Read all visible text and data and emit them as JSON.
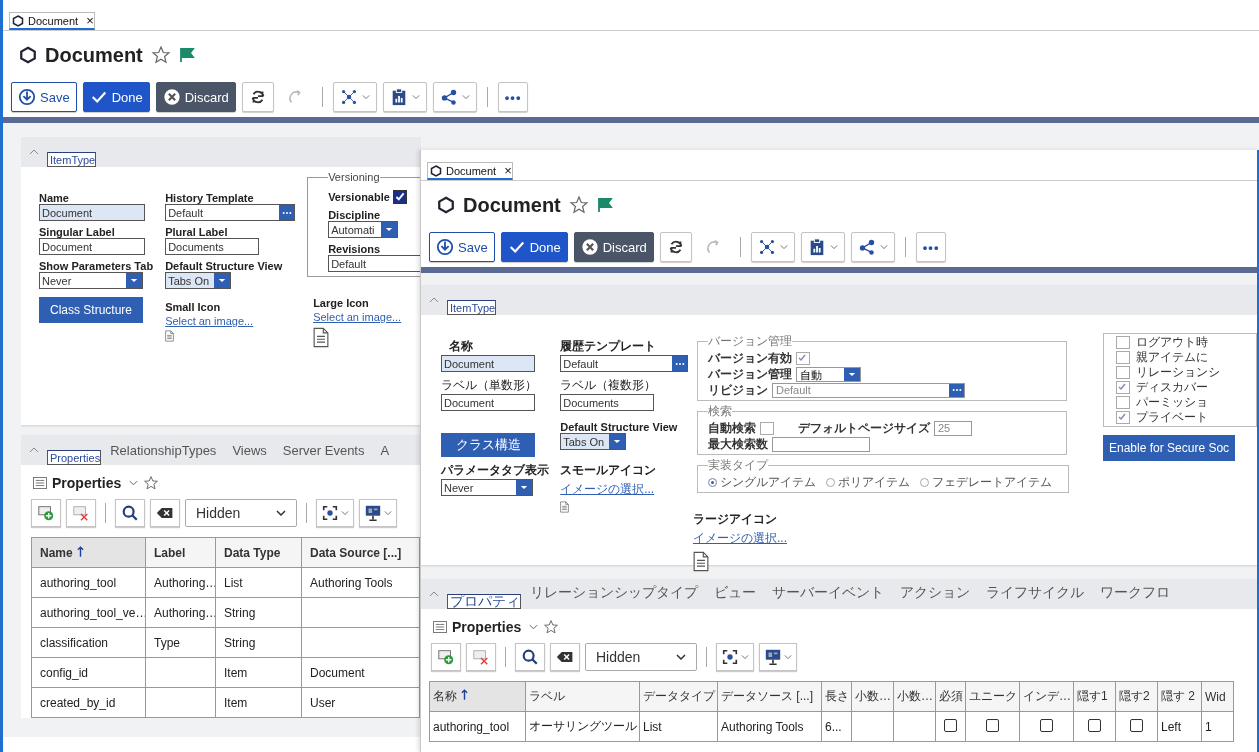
{
  "back_window": {
    "header": {
      "tab": {
        "label": "Document",
        "close": "×",
        "selected": true
      },
      "title": "Document",
      "save": "Save",
      "done": "Done",
      "discard": "Discard",
      "more": "•••"
    },
    "item_form": {
      "tab": {
        "label": "ItemType",
        "selected": true
      },
      "name": {
        "label": "Name",
        "value": "Document"
      },
      "history_template": {
        "label": "History Template",
        "value": "Default"
      },
      "singular_label": {
        "label": "Singular Label",
        "value": "Document"
      },
      "plural_label": {
        "label": "Plural Label",
        "value": "Documents"
      },
      "show_parameters_tab": {
        "label": "Show Parameters Tab",
        "value": "Never"
      },
      "default_structure_view": {
        "label": "Default Structure View",
        "value": "Tabs On"
      },
      "class_structure": "Class Structure",
      "small_icon": {
        "label": "Small Icon",
        "link": "Select an image..."
      },
      "large_icon": {
        "label": "Large Icon",
        "link": "Select an image..."
      },
      "versioning": {
        "legend": "Versioning",
        "versionable": {
          "label": "Versionable",
          "checked": true
        },
        "discipline": {
          "label": "Discipline",
          "value": "Automati"
        },
        "revisions": {
          "label": "Revisions",
          "value": "Default"
        }
      }
    },
    "properties": {
      "tabs": [
        {
          "label": "Properties",
          "selected": true
        },
        {
          "label": "RelationshipTypes",
          "selected": false
        },
        {
          "label": "Views",
          "selected": false
        },
        {
          "label": "Server Events",
          "selected": false
        },
        {
          "label": "A",
          "selected": false
        }
      ],
      "grid_title": "Properties",
      "filter": "Hidden",
      "columns": [
        {
          "label": "Name",
          "sorted": true
        },
        {
          "label": "Label",
          "sorted": false
        },
        {
          "label": "Data Type",
          "sorted": false
        },
        {
          "label": "Data Source [...]",
          "sorted": false
        }
      ],
      "rows": [
        {
          "cells": [
            {
              "kind": "text",
              "text": "authoring_tool"
            },
            {
              "kind": "text",
              "text": "Authoring…"
            },
            {
              "kind": "text",
              "text": "List"
            },
            {
              "kind": "text",
              "text": "Authoring Tools"
            }
          ]
        },
        {
          "cells": [
            {
              "kind": "text",
              "text": "authoring_tool_ve…"
            },
            {
              "kind": "text",
              "text": "Authoring…"
            },
            {
              "kind": "text",
              "text": "String"
            },
            {
              "kind": "empty"
            }
          ]
        },
        {
          "cells": [
            {
              "kind": "text",
              "text": "classification"
            },
            {
              "kind": "text",
              "text": "Type"
            },
            {
              "kind": "text",
              "text": "String"
            },
            {
              "kind": "empty"
            }
          ]
        },
        {
          "cells": [
            {
              "kind": "text",
              "text": "config_id"
            },
            {
              "kind": "empty"
            },
            {
              "kind": "text",
              "text": "Item"
            },
            {
              "kind": "text",
              "text": "Document"
            }
          ]
        },
        {
          "cells": [
            {
              "kind": "text",
              "text": "created_by_id"
            },
            {
              "kind": "empty"
            },
            {
              "kind": "text",
              "text": "Item"
            },
            {
              "kind": "text",
              "text": "User"
            }
          ]
        }
      ]
    }
  },
  "front_window": {
    "header": {
      "tab": {
        "label": "Document",
        "close": "×",
        "selected": true
      },
      "title": "Document",
      "save": "Save",
      "done": "Done",
      "discard": "Discard",
      "more": "•••"
    },
    "item_form": {
      "tab": {
        "label": "ItemType",
        "selected": true
      },
      "name": {
        "label": "名称",
        "value": "Document"
      },
      "history_template": {
        "label": "履歴テンプレート",
        "value": "Default"
      },
      "singular_label": {
        "label": "ラベル（単数形）",
        "value": "Document"
      },
      "plural_label": {
        "label": "ラベル（複数形）",
        "value": "Documents"
      },
      "default_structure_view": {
        "label": "Default Structure View",
        "value": "Tabs On"
      },
      "class_structure": "クラス構造",
      "show_parameters_tab": {
        "label": "パラメータタブ表示",
        "value": "Never"
      },
      "small_icon": {
        "label": "スモールアイコン",
        "link": "イメージの選択..."
      },
      "large_icon": {
        "label": "ラージアイコン",
        "link": "イメージの選択..."
      },
      "versioning": {
        "legend": "バージョン管理",
        "versionable": {
          "label": "バージョン有効",
          "checked": true
        },
        "discipline": {
          "label": "バージョン管理",
          "value": "自動"
        },
        "revisions": {
          "label": "リビジョン",
          "value": "Default"
        }
      },
      "search": {
        "legend": "検索",
        "auto_search": {
          "label": "自動検索",
          "checked": false
        },
        "page_size": {
          "label": "デフォルトページサイズ",
          "value": "25"
        },
        "max_search": {
          "label": "最大検索数"
        }
      },
      "implementation": {
        "legend": "実装タイプ",
        "options": [
          {
            "label": "シングルアイテム",
            "selected": true
          },
          {
            "label": "ポリアイテム",
            "selected": false
          },
          {
            "label": "フェデレートアイテム",
            "selected": false
          }
        ]
      },
      "options": [
        {
          "label": "ログアウト時",
          "checked": false
        },
        {
          "label": "親アイテムに",
          "checked": false
        },
        {
          "label": "リレーションシ",
          "checked": false
        },
        {
          "label": "ディスカバー",
          "checked": true
        },
        {
          "label": "パーミッショ",
          "checked": false
        },
        {
          "label": "プライベート",
          "checked": true
        }
      ],
      "secure_social": "Enable for Secure Soc"
    },
    "properties": {
      "tabs": [
        {
          "label": "プロパティ",
          "selected": true
        },
        {
          "label": "リレーションシップタイプ",
          "selected": false
        },
        {
          "label": "ビュー",
          "selected": false
        },
        {
          "label": "サーバーイベント",
          "selected": false
        },
        {
          "label": "アクション",
          "selected": false
        },
        {
          "label": "ライフサイクル",
          "selected": false
        },
        {
          "label": "ワークフロ",
          "selected": false
        }
      ],
      "grid_title": "Properties",
      "filter": "Hidden",
      "columns": [
        {
          "label": "名称",
          "sorted": true
        },
        {
          "label": "ラベル",
          "sorted": false
        },
        {
          "label": "データタイプ",
          "sorted": false
        },
        {
          "label": "データソース [...]",
          "sorted": false
        },
        {
          "label": "長さ",
          "sorted": false
        },
        {
          "label": "小数…",
          "sorted": false
        },
        {
          "label": "小数…",
          "sorted": false
        },
        {
          "label": "必須",
          "sorted": false
        },
        {
          "label": "ユニーク",
          "sorted": false
        },
        {
          "label": "インデ…",
          "sorted": false
        },
        {
          "label": "隠す1",
          "sorted": false
        },
        {
          "label": "隠す2",
          "sorted": false
        },
        {
          "label": "隠す 2",
          "sorted": false
        },
        {
          "label": "Wid",
          "sorted": false
        }
      ],
      "rows": [
        {
          "cells": [
            {
              "kind": "text",
              "text": "authoring_tool"
            },
            {
              "kind": "text",
              "text": "オーサリングツール"
            },
            {
              "kind": "text",
              "text": "List"
            },
            {
              "kind": "text",
              "text": "Authoring Tools"
            },
            {
              "kind": "text",
              "text": "6..."
            },
            {
              "kind": "empty"
            },
            {
              "kind": "empty"
            },
            {
              "kind": "check",
              "checked": false
            },
            {
              "kind": "check",
              "checked": false
            },
            {
              "kind": "check",
              "checked": false
            },
            {
              "kind": "check",
              "checked": false
            },
            {
              "kind": "check",
              "checked": false
            },
            {
              "kind": "text",
              "text": "Left"
            },
            {
              "kind": "text",
              "text": "1"
            }
          ]
        }
      ]
    }
  }
}
